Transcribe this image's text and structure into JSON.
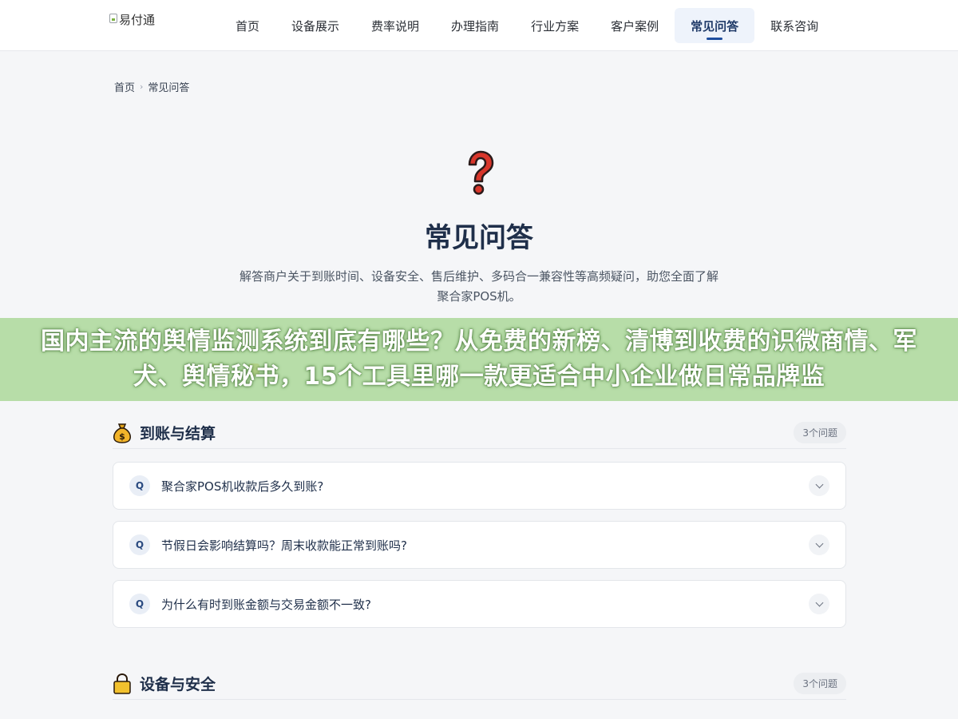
{
  "header": {
    "logo_alt": "易付通",
    "nav": [
      {
        "label": "首页",
        "active": false
      },
      {
        "label": "设备展示",
        "active": false
      },
      {
        "label": "费率说明",
        "active": false
      },
      {
        "label": "办理指南",
        "active": false
      },
      {
        "label": "行业方案",
        "active": false
      },
      {
        "label": "客户案例",
        "active": false
      },
      {
        "label": "常见问答",
        "active": true
      },
      {
        "label": "联系咨询",
        "active": false
      }
    ]
  },
  "breadcrumb": {
    "home": "首页",
    "current": "常见问答"
  },
  "hero": {
    "icon": "question-mark-icon",
    "title": "常见问答",
    "description": "解答商户关于到账时间、设备安全、售后维护、多码合一兼容性等高频疑问，助您全面了解聚合家POS机。"
  },
  "banner": {
    "text": "国内主流的舆情监测系统到底有哪些？从免费的新榜、清博到收费的识微商情、军犬、舆情秘书，15个工具里哪一款更适合中小企业做日常品牌监"
  },
  "sections": [
    {
      "icon": "money-bag-icon",
      "title": "到账与结算",
      "count": "3个问题",
      "questions": [
        "聚合家POS机收款后多久到账?",
        "节假日会影响结算吗？周末收款能正常到账吗?",
        "为什么有时到账金额与交易金额不一致?"
      ]
    },
    {
      "icon": "lock-icon",
      "title": "设备与安全",
      "count": "3个问题",
      "questions": []
    }
  ],
  "question_badge": "Q",
  "colors": {
    "nav_active_bg": "#eef3fb",
    "nav_active_underline": "#1f4e9e",
    "title": "#1f2f4a",
    "banner_bg": "#aad796"
  }
}
